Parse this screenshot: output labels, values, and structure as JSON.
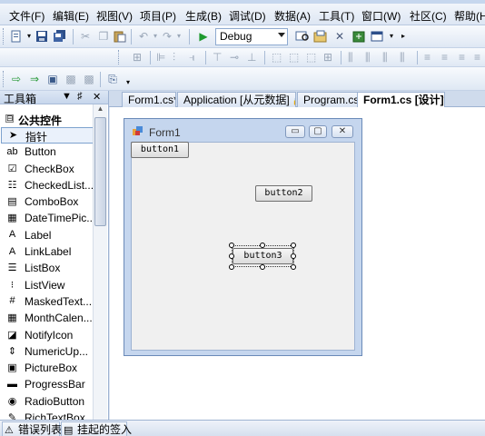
{
  "menu": [
    "文件(F)",
    "编辑(E)",
    "视图(V)",
    "项目(P)",
    "生成(B)",
    "调试(D)",
    "数据(A)",
    "工具(T)",
    "窗口(W)",
    "社区(C)",
    "帮助(H)"
  ],
  "toolbar": {
    "config_value": "Debug",
    "icons": [
      "new-project-icon",
      "save-icon",
      "save-all-icon",
      "cut-icon",
      "copy-icon",
      "paste-icon",
      "undo-icon",
      "redo-icon",
      "start-debug-icon",
      "find-icon",
      "solution-explorer-icon",
      "properties-icon",
      "toolbox-icon",
      "more-icon"
    ]
  },
  "toolbox": {
    "title": "工具箱",
    "header_controls": [
      "▼",
      "♯",
      "✕"
    ],
    "section_toggle": "⊟",
    "section": "公共控件",
    "items": [
      {
        "label": "指针",
        "icon": "pointer-icon",
        "glyph": "➤"
      },
      {
        "label": "Button",
        "icon": "button-icon",
        "glyph": "ab"
      },
      {
        "label": "CheckBox",
        "icon": "checkbox-icon",
        "glyph": "☑"
      },
      {
        "label": "CheckedList...",
        "icon": "checkedlistbox-icon",
        "glyph": "☷"
      },
      {
        "label": "ComboBox",
        "icon": "combobox-icon",
        "glyph": "▤"
      },
      {
        "label": "DateTimePic...",
        "icon": "datetimepicker-icon",
        "glyph": "▦"
      },
      {
        "label": "Label",
        "icon": "label-icon",
        "glyph": "A"
      },
      {
        "label": "LinkLabel",
        "icon": "linklabel-icon",
        "glyph": "A"
      },
      {
        "label": "ListBox",
        "icon": "listbox-icon",
        "glyph": "☰"
      },
      {
        "label": "ListView",
        "icon": "listview-icon",
        "glyph": "⁝"
      },
      {
        "label": "MaskedText...",
        "icon": "maskedtextbox-icon",
        "glyph": "#"
      },
      {
        "label": "MonthCalen...",
        "icon": "monthcalendar-icon",
        "glyph": "▦"
      },
      {
        "label": "NotifyIcon",
        "icon": "notifyicon-icon",
        "glyph": "◪"
      },
      {
        "label": "NumericUp...",
        "icon": "numericupdown-icon",
        "glyph": "⇕"
      },
      {
        "label": "PictureBox",
        "icon": "picturebox-icon",
        "glyph": "▣"
      },
      {
        "label": "ProgressBar",
        "icon": "progressbar-icon",
        "glyph": "▬"
      },
      {
        "label": "RadioButton",
        "icon": "radiobutton-icon",
        "glyph": "◉"
      },
      {
        "label": "RichTextBox",
        "icon": "richtextbox-icon",
        "glyph": "✎"
      }
    ]
  },
  "tabs": [
    {
      "label": "Form1.cs*",
      "active": false
    },
    {
      "label": "Application [从元数据]",
      "active": false
    },
    {
      "label": "Program.cs",
      "active": false
    },
    {
      "label": "Form1.cs [设计]*",
      "active": true
    }
  ],
  "form": {
    "title": "Form1",
    "caption_buttons": [
      "▭",
      "▢",
      "✕"
    ],
    "buttons": [
      "button1",
      "button2",
      "button3"
    ],
    "selected_button": "button3"
  },
  "bottom_tabs": [
    {
      "label": "错误列表",
      "icon": "error-list-icon"
    },
    {
      "label": "挂起的签入",
      "icon": "pending-checkins-icon"
    }
  ],
  "colors": {
    "chrome": "#dbe4f1",
    "form_frame": "#c5d6ee",
    "client": "#f0f0f0"
  }
}
